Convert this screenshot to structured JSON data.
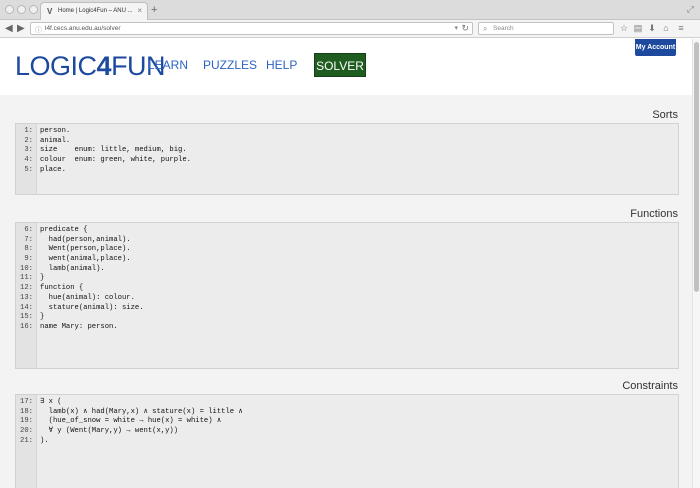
{
  "browser": {
    "tab_title": "Home | Logic4Fun – ANU ...",
    "tab_favicon": "V",
    "new_tab_glyph": "+",
    "url": "l4f.cecs.anu.edu.au/solver",
    "search_placeholder": "Search"
  },
  "site": {
    "logo_prefix": "LOGIC",
    "logo_bold": "4",
    "logo_suffix": "FUN",
    "nav": [
      {
        "label": "LEARN"
      },
      {
        "label": "PUZZLES"
      },
      {
        "label": "HELP"
      },
      {
        "label": "SOLVER"
      }
    ],
    "account_label": "My Account"
  },
  "sections": [
    {
      "title": "Sorts",
      "lines": [
        {
          "num": "1:",
          "code": "person."
        },
        {
          "num": "2:",
          "code": "animal."
        },
        {
          "num": "3:",
          "code": "size    enum: little, medium, big."
        },
        {
          "num": "4:",
          "code": "colour  enum: green, white, purple."
        },
        {
          "num": "5:",
          "code": "place."
        }
      ]
    },
    {
      "title": "Functions",
      "lines": [
        {
          "num": "6:",
          "code": "predicate {"
        },
        {
          "num": "7:",
          "code": "  had(person,animal)."
        },
        {
          "num": "8:",
          "code": "  Went(person,place)."
        },
        {
          "num": "9:",
          "code": "  went(animal,place)."
        },
        {
          "num": "10:",
          "code": "  lamb(animal)."
        },
        {
          "num": "11:",
          "code": "}"
        },
        {
          "num": "12:",
          "code": "function {"
        },
        {
          "num": "13:",
          "code": "  hue(animal): colour."
        },
        {
          "num": "14:",
          "code": "  stature(animal): size."
        },
        {
          "num": "15:",
          "code": "}"
        },
        {
          "num": "16:",
          "code": "name Mary: person."
        }
      ]
    },
    {
      "title": "Constraints",
      "lines": [
        {
          "num": "17:",
          "code": "∃ x ("
        },
        {
          "num": "18:",
          "code": "  lamb(x) ∧ had(Mary,x) ∧ stature(x) = little ∧"
        },
        {
          "num": "19:",
          "code": "  (hue_of_snow = white → hue(x) = white) ∧"
        },
        {
          "num": "20:",
          "code": "  ∀ y (Went(Mary,y) → went(x,y))"
        },
        {
          "num": "21:",
          "code": ")."
        }
      ]
    }
  ],
  "colors": {
    "brand_blue": "#1d4a9e",
    "solver_green": "#1f5c1f"
  }
}
